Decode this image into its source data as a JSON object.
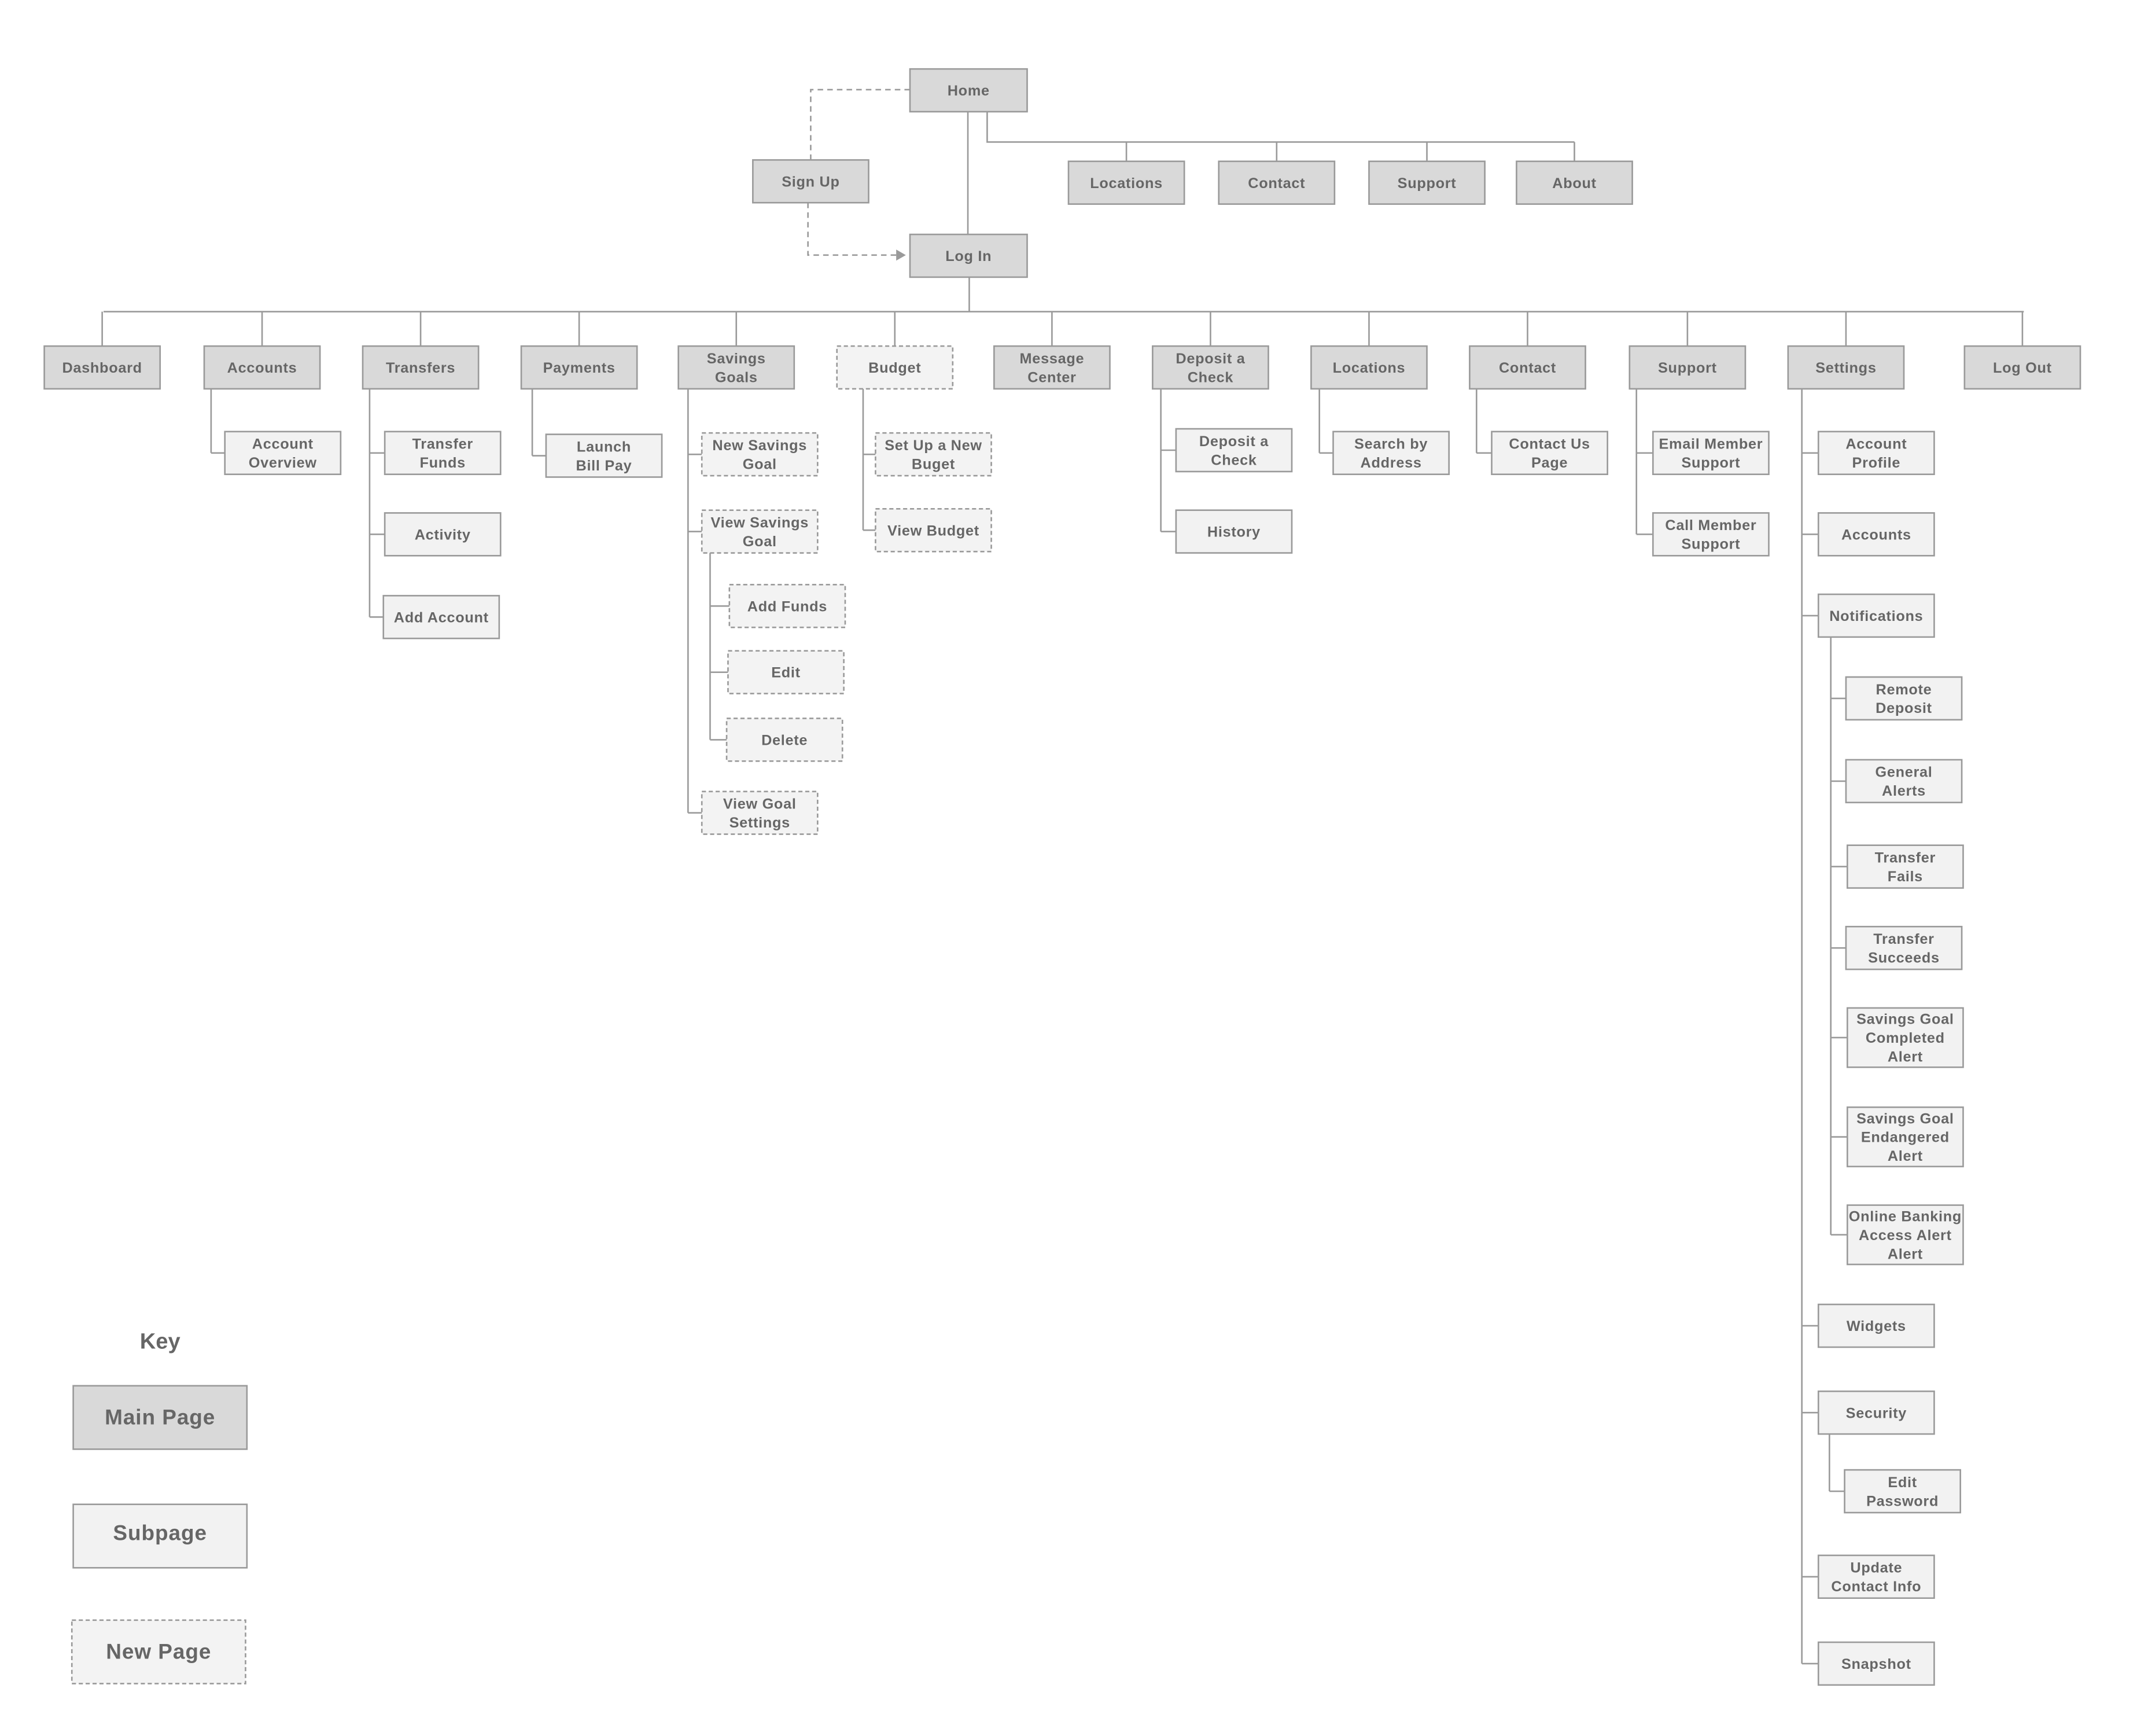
{
  "colors": {
    "main_fill": "#d9d9d9",
    "subpage_fill": "#f2f2f2",
    "new_fill": "#f3f3f3",
    "stroke": "#9a9a9a",
    "text": "#666666"
  },
  "nodes": [
    {
      "lines": [
        "Home"
      ],
      "type": "main"
    },
    {
      "lines": [
        "Sign Up"
      ],
      "type": "main"
    },
    {
      "lines": [
        "Log In"
      ],
      "type": "main"
    },
    {
      "lines": [
        "Locations"
      ],
      "type": "main"
    },
    {
      "lines": [
        "Contact"
      ],
      "type": "main"
    },
    {
      "lines": [
        "Support"
      ],
      "type": "main"
    },
    {
      "lines": [
        "About"
      ],
      "type": "main"
    },
    {
      "lines": [
        "Dashboard"
      ],
      "type": "main"
    },
    {
      "lines": [
        "Accounts"
      ],
      "type": "main"
    },
    {
      "lines": [
        "Transfers"
      ],
      "type": "main"
    },
    {
      "lines": [
        "Payments"
      ],
      "type": "main"
    },
    {
      "lines": [
        "Savings",
        "Goals"
      ],
      "type": "main"
    },
    {
      "lines": [
        "Budget"
      ],
      "type": "new"
    },
    {
      "lines": [
        "Message",
        "Center"
      ],
      "type": "main"
    },
    {
      "lines": [
        "Deposit a",
        "Check"
      ],
      "type": "main"
    },
    {
      "lines": [
        "Locations"
      ],
      "type": "main"
    },
    {
      "lines": [
        "Contact"
      ],
      "type": "main"
    },
    {
      "lines": [
        "Support"
      ],
      "type": "main"
    },
    {
      "lines": [
        "Settings"
      ],
      "type": "main"
    },
    {
      "lines": [
        "Log Out"
      ],
      "type": "main"
    },
    {
      "lines": [
        "Account",
        "Overview"
      ],
      "type": "sub"
    },
    {
      "lines": [
        "Transfer",
        "Funds"
      ],
      "type": "sub"
    },
    {
      "lines": [
        "Activity"
      ],
      "type": "sub"
    },
    {
      "lines": [
        "Add Account"
      ],
      "type": "sub"
    },
    {
      "lines": [
        "Launch",
        "Bill Pay"
      ],
      "type": "sub"
    },
    {
      "lines": [
        "New Savings",
        "Goal"
      ],
      "type": "new"
    },
    {
      "lines": [
        "View Savings",
        "Goal"
      ],
      "type": "new"
    },
    {
      "lines": [
        "Add Funds"
      ],
      "type": "new"
    },
    {
      "lines": [
        "Edit"
      ],
      "type": "new"
    },
    {
      "lines": [
        "Delete"
      ],
      "type": "new"
    },
    {
      "lines": [
        "View Goal",
        "Settings"
      ],
      "type": "new"
    },
    {
      "lines": [
        "Set Up a New",
        "Buget"
      ],
      "type": "new"
    },
    {
      "lines": [
        "View Budget"
      ],
      "type": "new"
    },
    {
      "lines": [
        "Deposit a",
        "Check"
      ],
      "type": "sub"
    },
    {
      "lines": [
        "History"
      ],
      "type": "sub"
    },
    {
      "lines": [
        "Search by",
        "Address"
      ],
      "type": "sub"
    },
    {
      "lines": [
        "Contact Us",
        "Page"
      ],
      "type": "sub"
    },
    {
      "lines": [
        "Email Member",
        "Support"
      ],
      "type": "sub"
    },
    {
      "lines": [
        "Call Member",
        "Support"
      ],
      "type": "sub"
    },
    {
      "lines": [
        "Account",
        "Profile"
      ],
      "type": "sub"
    },
    {
      "lines": [
        "Accounts"
      ],
      "type": "sub"
    },
    {
      "lines": [
        "Notifications"
      ],
      "type": "sub"
    },
    {
      "lines": [
        "Remote",
        "Deposit"
      ],
      "type": "sub"
    },
    {
      "lines": [
        "General",
        "Alerts"
      ],
      "type": "sub"
    },
    {
      "lines": [
        "Transfer",
        "Fails"
      ],
      "type": "sub"
    },
    {
      "lines": [
        "Transfer",
        "Succeeds"
      ],
      "type": "sub"
    },
    {
      "lines": [
        "Savings Goal",
        "Completed",
        "Alert"
      ],
      "type": "sub"
    },
    {
      "lines": [
        "Savings Goal",
        "Endangered",
        "Alert"
      ],
      "type": "sub"
    },
    {
      "lines": [
        "Online Banking",
        "Access Alert",
        "Alert"
      ],
      "type": "sub"
    },
    {
      "lines": [
        "Widgets"
      ],
      "type": "sub"
    },
    {
      "lines": [
        "Security"
      ],
      "type": "sub"
    },
    {
      "lines": [
        "Edit",
        "Password"
      ],
      "type": "sub"
    },
    {
      "lines": [
        "Update",
        "Contact Info"
      ],
      "type": "sub"
    },
    {
      "lines": [
        "Snapshot"
      ],
      "type": "sub"
    }
  ],
  "key": {
    "title": "Key",
    "items": [
      {
        "label": "Main Page",
        "type": "main"
      },
      {
        "label": "Subpage",
        "type": "sub"
      },
      {
        "label": "New Page",
        "type": "new"
      }
    ]
  }
}
